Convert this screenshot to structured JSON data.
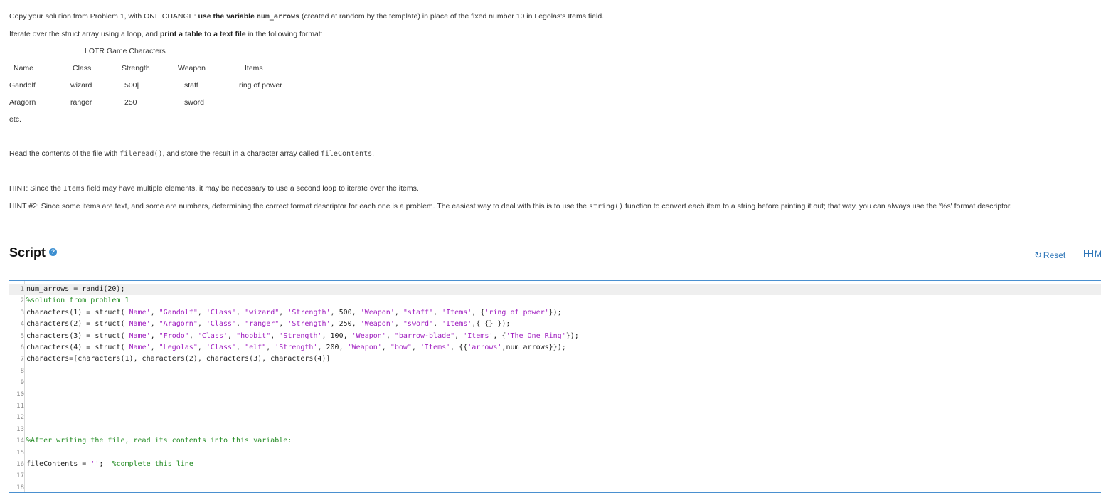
{
  "instructions": {
    "line1_pre": "Copy your solution from Problem 1, with ONE CHANGE: ",
    "line1_bold": "use the variable ",
    "line1_code": "num_arrows",
    "line1_post": " (created at random by the template) in place of the fixed number 10 in Legolas's Items field.",
    "line2_pre": "Iterate over the struct array using a loop, and ",
    "line2_bold": "print a table to a text file",
    "line2_post": " in the following format:",
    "table_title": "LOTR Game Characters",
    "table_headers": [
      "Name",
      "Class",
      "Strength",
      "Weapon",
      "Items"
    ],
    "table_rows": [
      [
        "Gandolf",
        "wizard",
        "500|",
        "staff",
        "ring of power"
      ],
      [
        "Aragorn",
        "ranger",
        "250",
        "sword",
        ""
      ]
    ],
    "etc": "etc.",
    "read_pre": "Read the contents of the file with ",
    "read_code1": "fileread()",
    "read_mid": ", and store the result in a character array called ",
    "read_code2": "fileContents",
    "read_post": ".",
    "hint1_pre": "HINT: Since the ",
    "hint1_code": "Items",
    "hint1_post": " field may have multiple elements, it may be necessary to use a second loop to iterate over the items.",
    "hint2_pre": "HINT #2: Since some items are text, and some are numbers, determining the correct format descriptor for each one is a problem. The easiest way to deal with this is to use the ",
    "hint2_code": "string()",
    "hint2_post": " function to convert each item to a string before printing it out; that way, you can always use the '%s' format descriptor."
  },
  "script": {
    "heading": "Script",
    "help_icon": "question-icon",
    "reset_label": "Reset",
    "more_label": "M"
  },
  "editor": {
    "lines": [
      "num_arrows = randi(20);",
      "%solution from problem 1",
      "characters(1) = struct('Name', \"Gandolf\", 'Class', \"wizard\", 'Strength', 500, 'Weapon', \"staff\", 'Items', {'ring of power'});",
      "characters(2) = struct('Name', \"Aragorn\", 'Class', \"ranger\", 'Strength', 250, 'Weapon', \"sword\", 'Items',{ {} });",
      "characters(3) = struct('Name', \"Frodo\", 'Class', \"hobbit\", 'Strength', 100, 'Weapon', \"barrow-blade\", 'Items', {'The One Ring'});",
      "characters(4) = struct('Name', \"Legolas\", 'Class', \"elf\", 'Strength', 200, 'Weapon', \"bow\", 'Items', {{'arrows',num_arrows}});",
      "characters=[characters(1), characters(2), characters(3), characters(4)]",
      "",
      "",
      "",
      "",
      "",
      "",
      "%After writing the file, read its contents into this variable:",
      "",
      "fileContents = '';  %complete this line",
      "",
      ""
    ]
  }
}
